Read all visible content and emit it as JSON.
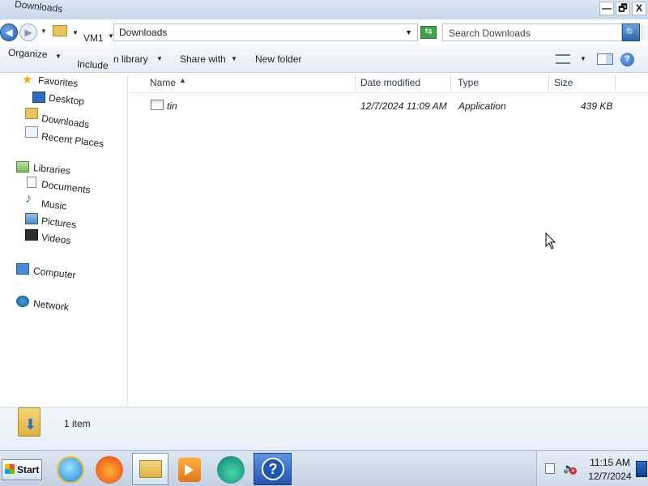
{
  "window": {
    "title": "Downloads",
    "controls": {
      "minimize": "—",
      "restore": "🗗",
      "close": "X"
    }
  },
  "address_bar": {
    "crumbs": [
      "VM1",
      "Downloads"
    ],
    "search_placeholder": "Search Downloads"
  },
  "toolbar": {
    "organize": "Organize",
    "include_in_library_a": "Include",
    "include_in_library_b": "n library",
    "share_with": "Share with",
    "new_folder": "New folder"
  },
  "navigation": {
    "favorites": "Favorites",
    "favorites_items": [
      "Desktop",
      "Downloads",
      "Recent Places"
    ],
    "libraries": "Libraries",
    "libraries_items": [
      "Documents",
      "Music",
      "Pictures",
      "Videos"
    ],
    "computer": "Computer",
    "network": "Network"
  },
  "file_list": {
    "columns": [
      "Name",
      "Date modified",
      "Type",
      "Size"
    ],
    "rows": [
      {
        "name": "tin",
        "date_modified": "12/7/2024 11:09 AM",
        "type": "Application",
        "size": "439 KB"
      }
    ]
  },
  "details_pane": {
    "item_count": "1 item"
  },
  "taskbar": {
    "start_label": "Start",
    "pinned": [
      "internet-explorer",
      "firefox",
      "windows-explorer",
      "media-player",
      "edge",
      "help"
    ],
    "clock_time": "11:15 AM",
    "clock_date": "12/7/2024"
  },
  "colors": {
    "titlebar": "#c9d8ec",
    "toolbar": "#e4ecf6",
    "taskbar": "#c3d1e3",
    "accent": "#1d5fb6"
  }
}
